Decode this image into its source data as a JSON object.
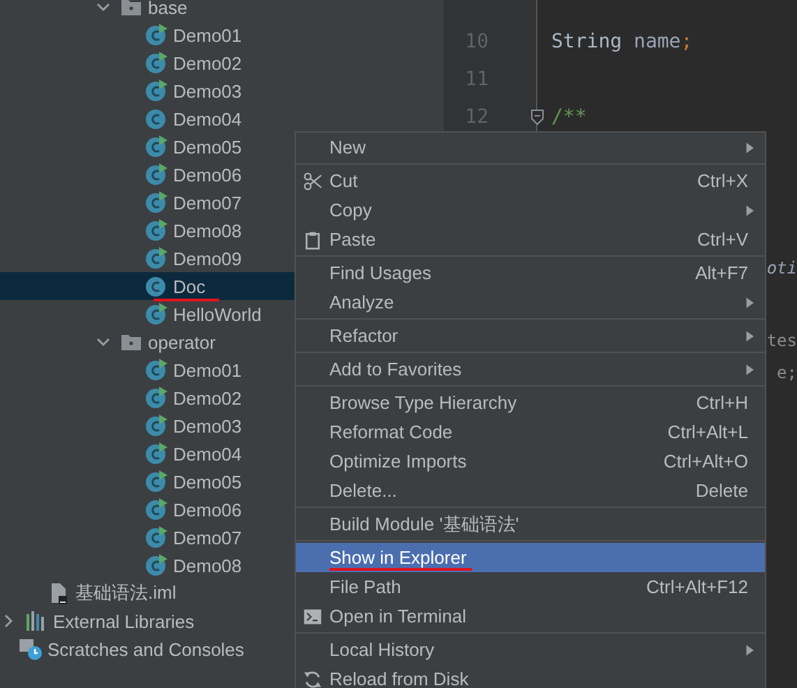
{
  "project_tree": [
    {
      "kind": "folder",
      "label": "base",
      "expanded": true,
      "selected": false,
      "annotated": false,
      "children": [
        {
          "kind": "class",
          "label": "Demo01",
          "runnable": true,
          "selected": false,
          "annotated": false
        },
        {
          "kind": "class",
          "label": "Demo02",
          "runnable": true,
          "selected": false,
          "annotated": false
        },
        {
          "kind": "class",
          "label": "Demo03",
          "runnable": true,
          "selected": false,
          "annotated": false
        },
        {
          "kind": "class",
          "label": "Demo04",
          "runnable": false,
          "selected": false,
          "annotated": false
        },
        {
          "kind": "class",
          "label": "Demo05",
          "runnable": true,
          "selected": false,
          "annotated": false
        },
        {
          "kind": "class",
          "label": "Demo06",
          "runnable": true,
          "selected": false,
          "annotated": false
        },
        {
          "kind": "class",
          "label": "Demo07",
          "runnable": true,
          "selected": false,
          "annotated": false
        },
        {
          "kind": "class",
          "label": "Demo08",
          "runnable": true,
          "selected": false,
          "annotated": false
        },
        {
          "kind": "class",
          "label": "Demo09",
          "runnable": true,
          "selected": false,
          "annotated": false
        },
        {
          "kind": "class",
          "label": "Doc",
          "runnable": false,
          "selected": true,
          "annotated": true
        },
        {
          "kind": "class",
          "label": "HelloWorld",
          "runnable": true,
          "selected": false,
          "annotated": false
        }
      ]
    },
    {
      "kind": "folder",
      "label": "operator",
      "expanded": true,
      "selected": false,
      "annotated": false,
      "children": [
        {
          "kind": "class",
          "label": "Demo01",
          "runnable": true,
          "selected": false,
          "annotated": false
        },
        {
          "kind": "class",
          "label": "Demo02",
          "runnable": true,
          "selected": false,
          "annotated": false
        },
        {
          "kind": "class",
          "label": "Demo03",
          "runnable": true,
          "selected": false,
          "annotated": false
        },
        {
          "kind": "class",
          "label": "Demo04",
          "runnable": true,
          "selected": false,
          "annotated": false
        },
        {
          "kind": "class",
          "label": "Demo05",
          "runnable": true,
          "selected": false,
          "annotated": false
        },
        {
          "kind": "class",
          "label": "Demo06",
          "runnable": true,
          "selected": false,
          "annotated": false
        },
        {
          "kind": "class",
          "label": "Demo07",
          "runnable": true,
          "selected": false,
          "annotated": false
        },
        {
          "kind": "class",
          "label": "Demo08",
          "runnable": true,
          "selected": false,
          "annotated": false
        }
      ]
    },
    {
      "kind": "module_file",
      "label": "基础语法.iml",
      "selected": false,
      "annotated": false
    },
    {
      "kind": "library",
      "label": "External Libraries",
      "expanded": false,
      "selected": false,
      "annotated": false
    },
    {
      "kind": "scratches",
      "label": "Scratches and Consoles",
      "selected": false,
      "annotated": false
    }
  ],
  "editor": {
    "lines": [
      {
        "number": "10",
        "tokens": [
          {
            "text": "String",
            "kind": "type"
          },
          {
            "text": "name",
            "kind": "field"
          },
          {
            "text": ";",
            "kind": "punct"
          }
        ]
      },
      {
        "number": "11"
      },
      {
        "number": "12",
        "tokens": [
          {
            "text": "/**",
            "kind": "comment"
          }
        ]
      }
    ],
    "fragments": [
      {
        "text": "oti",
        "kind": "italic"
      },
      {
        "text": "tes",
        "kind": "plain"
      },
      {
        "text": "e;",
        "kind": "plain"
      }
    ]
  },
  "context_menu": {
    "groups": [
      [
        {
          "label": "New",
          "submenu": true,
          "selected": false
        }
      ],
      [
        {
          "label": "Cut",
          "shortcut": "Ctrl+X",
          "submenu": false,
          "selected": false
        },
        {
          "label": "Copy",
          "submenu": true,
          "selected": false
        },
        {
          "label": "Paste",
          "shortcut": "Ctrl+V",
          "submenu": false,
          "selected": false
        }
      ],
      [
        {
          "label": "Find Usages",
          "shortcut": "Alt+F7",
          "submenu": false,
          "selected": false
        },
        {
          "label": "Analyze",
          "submenu": true,
          "selected": false
        }
      ],
      [
        {
          "label": "Refactor",
          "submenu": true,
          "selected": false
        }
      ],
      [
        {
          "label": "Add to Favorites",
          "submenu": true,
          "selected": false
        }
      ],
      [
        {
          "label": "Browse Type Hierarchy",
          "shortcut": "Ctrl+H",
          "submenu": false,
          "selected": false
        },
        {
          "label": "Reformat Code",
          "shortcut": "Ctrl+Alt+L",
          "submenu": false,
          "selected": false
        },
        {
          "label": "Optimize Imports",
          "shortcut": "Ctrl+Alt+O",
          "submenu": false,
          "selected": false
        },
        {
          "label": "Delete...",
          "shortcut": "Delete",
          "submenu": false,
          "selected": false
        }
      ],
      [
        {
          "label": "Build Module '基础语法'",
          "submenu": false,
          "selected": false
        }
      ],
      [
        {
          "label": "Show in Explorer",
          "submenu": false,
          "selected": true
        },
        {
          "label": "File Path",
          "shortcut": "Ctrl+Alt+F12",
          "submenu": false,
          "selected": false
        },
        {
          "label": "Open in Terminal",
          "submenu": false,
          "selected": false
        }
      ],
      [
        {
          "label": "Local History",
          "submenu": true,
          "selected": false
        },
        {
          "label": "Reload from Disk",
          "submenu": false,
          "selected": false
        }
      ]
    ]
  }
}
